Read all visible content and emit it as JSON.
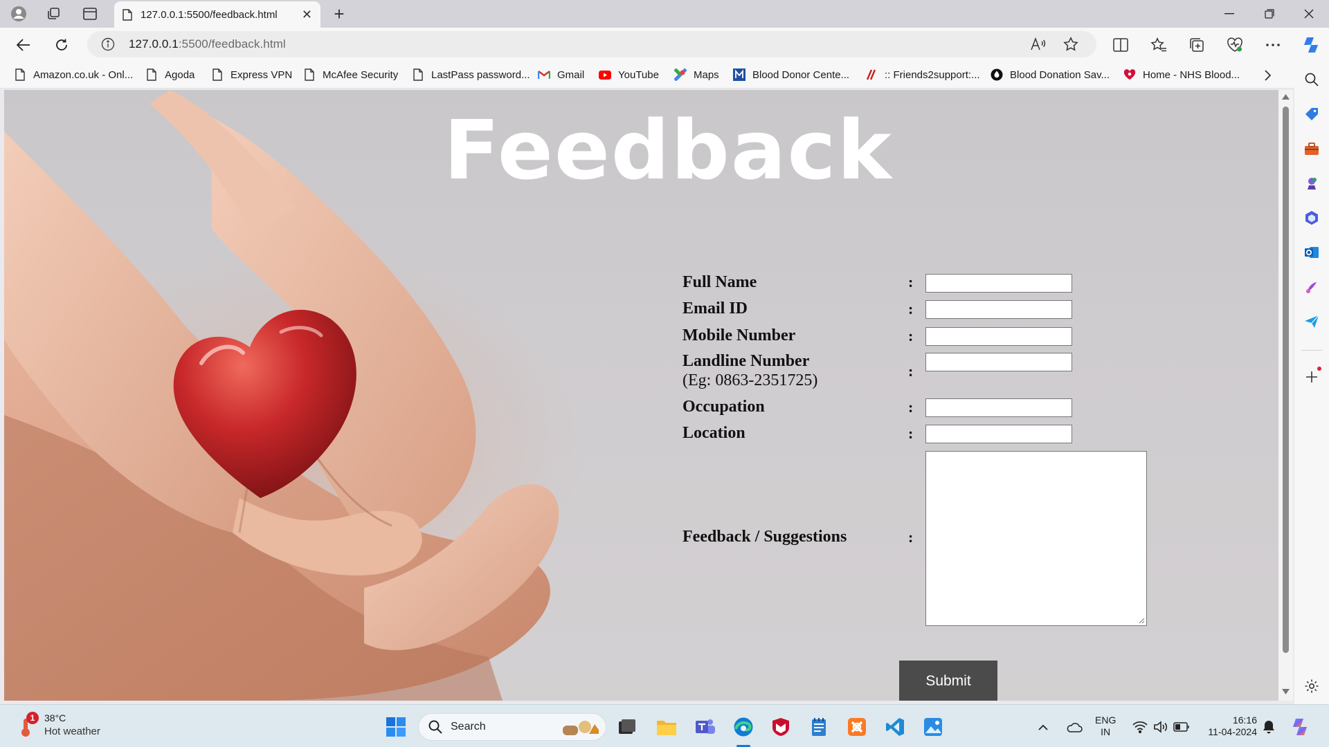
{
  "browser": {
    "tab_title": "127.0.0.1:5500/feedback.html",
    "url_host": "127.0.0.1",
    "url_rest": ":5500/feedback.html"
  },
  "bookmarks": [
    {
      "label": "Amazon.co.uk - Onl...",
      "icon": "page-icon"
    },
    {
      "label": "Agoda",
      "icon": "page-icon"
    },
    {
      "label": "Express VPN",
      "icon": "page-icon"
    },
    {
      "label": "McAfee Security",
      "icon": "page-icon"
    },
    {
      "label": "LastPass password...",
      "icon": "page-icon"
    },
    {
      "label": "Gmail",
      "icon": "gmail-icon"
    },
    {
      "label": "YouTube",
      "icon": "youtube-icon"
    },
    {
      "label": "Maps",
      "icon": "maps-icon"
    },
    {
      "label": "Blood Donor Cente...",
      "icon": "blood-donor-icon"
    },
    {
      "label": ":: Friends2support:...",
      "icon": "friends2support-icon"
    },
    {
      "label": "Blood Donation Sav...",
      "icon": "blood-donation-icon"
    },
    {
      "label": "Home - NHS Blood...",
      "icon": "nhs-blood-icon"
    }
  ],
  "page": {
    "heading": "Feedback",
    "form": {
      "full_name": "Full Name",
      "email": "Email ID",
      "mobile": "Mobile Number",
      "landline": "Landline Number",
      "landline_hint": "(Eg: 0863-2351725)",
      "occupation": "Occupation",
      "location": "Location",
      "feedback": "Feedback / Suggestions",
      "colon": ":",
      "submit": "Submit"
    }
  },
  "taskbar": {
    "weather_temp": "38°C",
    "weather_desc": "Hot weather",
    "weather_badge": "1",
    "search_placeholder": "Search",
    "lang_1": "ENG",
    "lang_2": "IN",
    "time": "16:16",
    "date": "11-04-2024"
  },
  "colors": {
    "submit_bg": "#4b4b4b",
    "heading": "#ffffff",
    "edge_blue": "#0f7bd6"
  }
}
